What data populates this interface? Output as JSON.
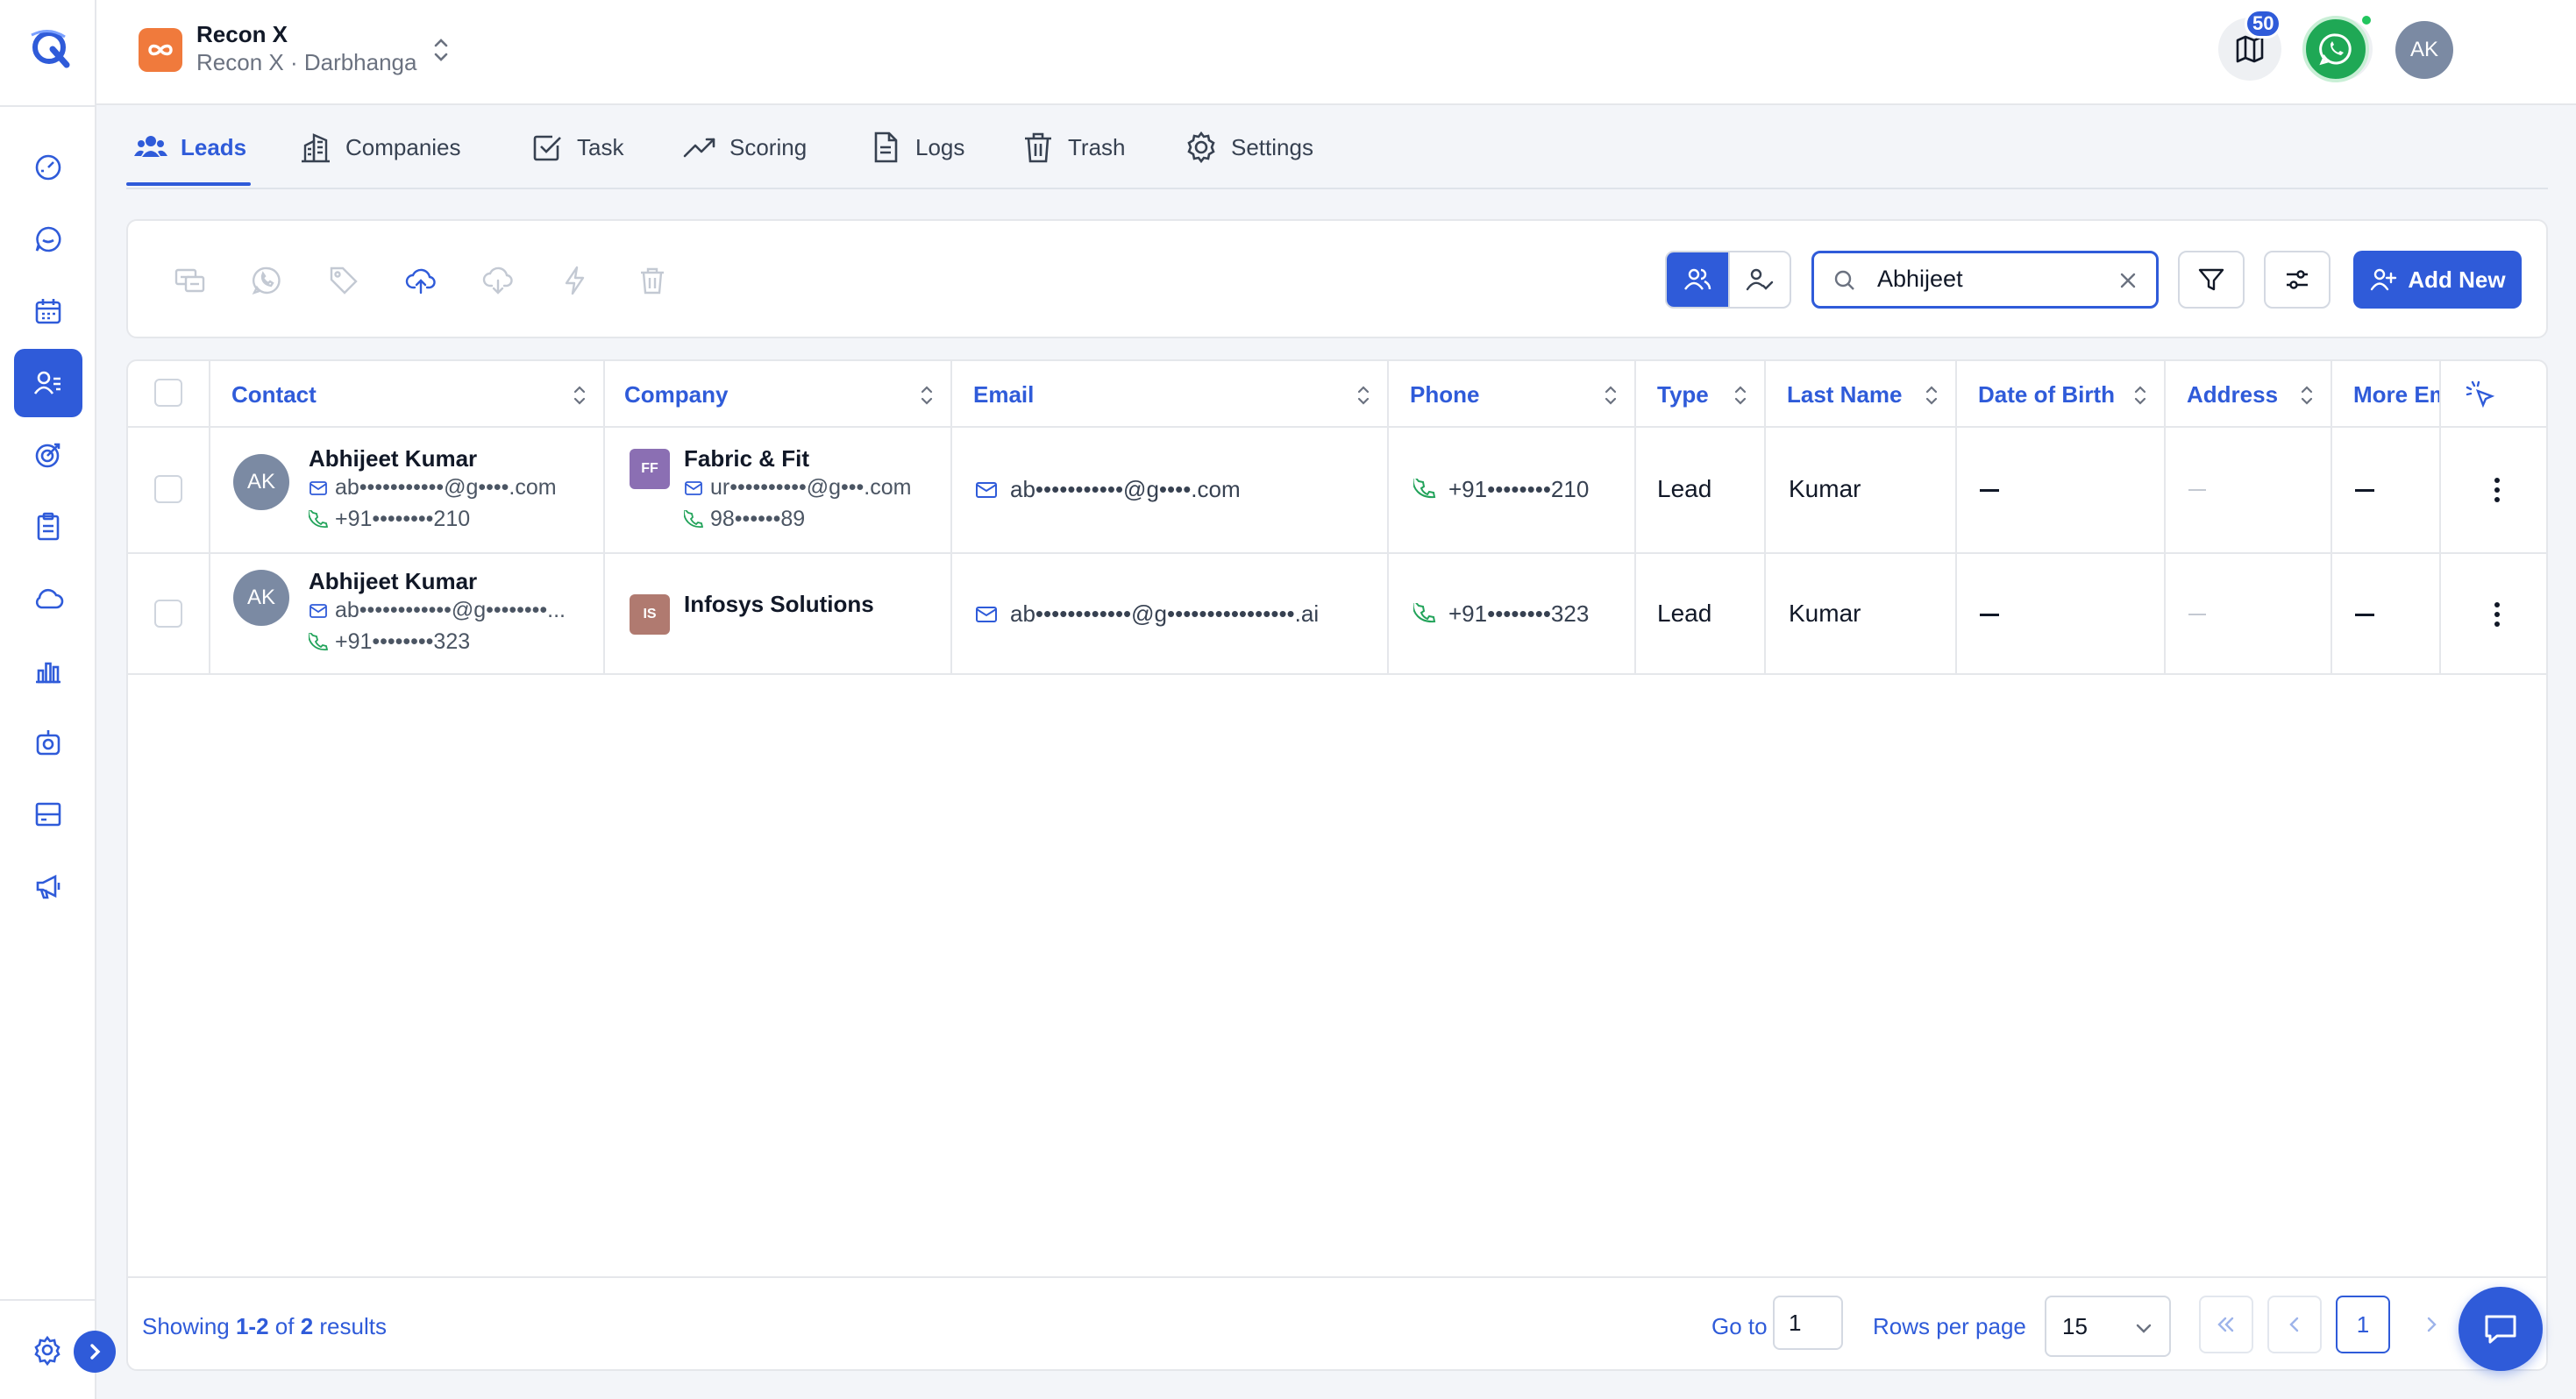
{
  "brand": {
    "accent": "#2f5bd9",
    "org_badge_color": "#f07a3c"
  },
  "org": {
    "name": "Recon X",
    "subtitle": "Recon X · Darbhanga"
  },
  "header": {
    "notifications_count": "50",
    "user_initials": "AK"
  },
  "sidebar": {
    "items": [
      {
        "icon": "dashboard-gauge-icon"
      },
      {
        "icon": "chat-bubble-icon"
      },
      {
        "icon": "calendar-icon"
      },
      {
        "icon": "contacts-list-icon",
        "active": true
      },
      {
        "icon": "target-icon"
      },
      {
        "icon": "clipboard-icon"
      },
      {
        "icon": "cloud-icon"
      },
      {
        "icon": "bar-chart-icon"
      },
      {
        "icon": "camera-icon"
      },
      {
        "icon": "layout-card-icon"
      },
      {
        "icon": "megaphone-icon"
      }
    ]
  },
  "tabs": [
    {
      "label": "Leads",
      "icon": "users-icon",
      "active": true
    },
    {
      "label": "Companies",
      "icon": "building-icon"
    },
    {
      "label": "Task",
      "icon": "checkbox-icon"
    },
    {
      "label": "Scoring",
      "icon": "trend-up-icon"
    },
    {
      "label": "Logs",
      "icon": "document-icon"
    },
    {
      "label": "Trash",
      "icon": "trash-icon"
    },
    {
      "label": "Settings",
      "icon": "gear-icon"
    }
  ],
  "toolbar": {
    "search_value": "Abhijeet",
    "add_new_label": "Add New"
  },
  "table": {
    "columns": [
      "Contact",
      "Company",
      "Email",
      "Phone",
      "Type",
      "Last Name",
      "Date of Birth",
      "Address",
      "More Em"
    ],
    "rows": [
      {
        "initials": "AK",
        "name": "Abhijeet Kumar",
        "email": "ab•••••••••••@g••••.com",
        "phone": "+91••••••••210",
        "company": {
          "initials": "FF",
          "name": "Fabric & Fit",
          "email": "ur••••••••••@g•••.com",
          "phone": "98••••••89",
          "color": "#8b6fb3"
        },
        "email_col": "ab•••••••••••@g••••.com",
        "phone_col": "+91••••••••210",
        "type": "Lead",
        "last_name": "Kumar"
      },
      {
        "initials": "AK",
        "name": "Abhijeet Kumar",
        "email": "ab••••••••••••@g••••••••...",
        "phone": "+91••••••••323",
        "company": {
          "initials": "IS",
          "name": "Infosys Solutions",
          "color": "#b07a70"
        },
        "email_col": "ab••••••••••••@g••••••••••••••••.ai",
        "phone_col": "+91••••••••323",
        "type": "Lead",
        "last_name": "Kumar"
      }
    ]
  },
  "footer": {
    "showing_prefix": "Showing ",
    "showing_range": "1-2",
    "showing_of": " of ",
    "showing_total": "2",
    "showing_suffix": " results",
    "goto_label": "Go to",
    "goto_value": "1",
    "rows_per_page_label": "Rows per page",
    "rows_per_page_value": "15",
    "current_page": "1"
  }
}
